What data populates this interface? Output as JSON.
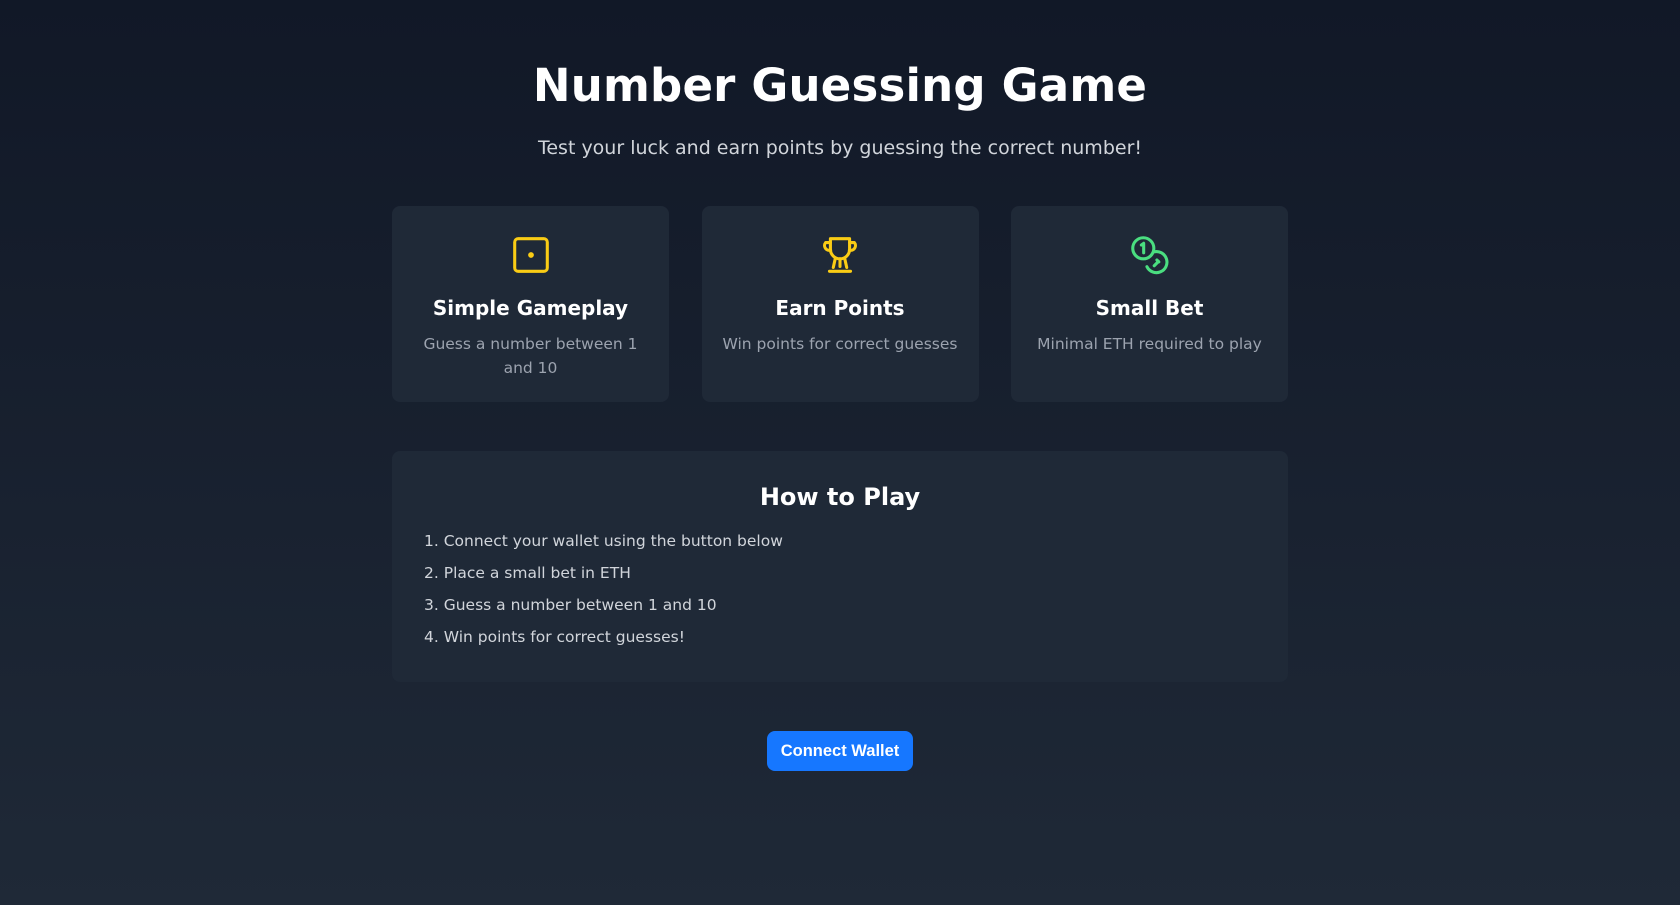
{
  "header": {
    "title": "Number Guessing Game",
    "subtitle": "Test your luck and earn points by guessing the correct number!"
  },
  "features": [
    {
      "icon": "dice-icon",
      "icon_color": "#facc15",
      "title": "Simple Gameplay",
      "text": "Guess a number between 1 and 10"
    },
    {
      "icon": "trophy-icon",
      "icon_color": "#facc15",
      "title": "Earn Points",
      "text": "Win points for correct guesses"
    },
    {
      "icon": "coins-icon",
      "icon_color": "#4ade80",
      "title": "Small Bet",
      "text": "Minimal ETH required to play"
    }
  ],
  "how_to_play": {
    "title": "How to Play",
    "steps": [
      "1. Connect your wallet using the button below",
      "2. Place a small bet in ETH",
      "3. Guess a number between 1 and 10",
      "4. Win points for correct guesses!"
    ]
  },
  "actions": {
    "connect_label": "Connect Wallet"
  },
  "colors": {
    "background_top": "#111827",
    "background_bottom": "#1f2937",
    "card_bg": "#1f2937",
    "accent_button": "#1677ff",
    "muted_text": "#9ca3af"
  }
}
